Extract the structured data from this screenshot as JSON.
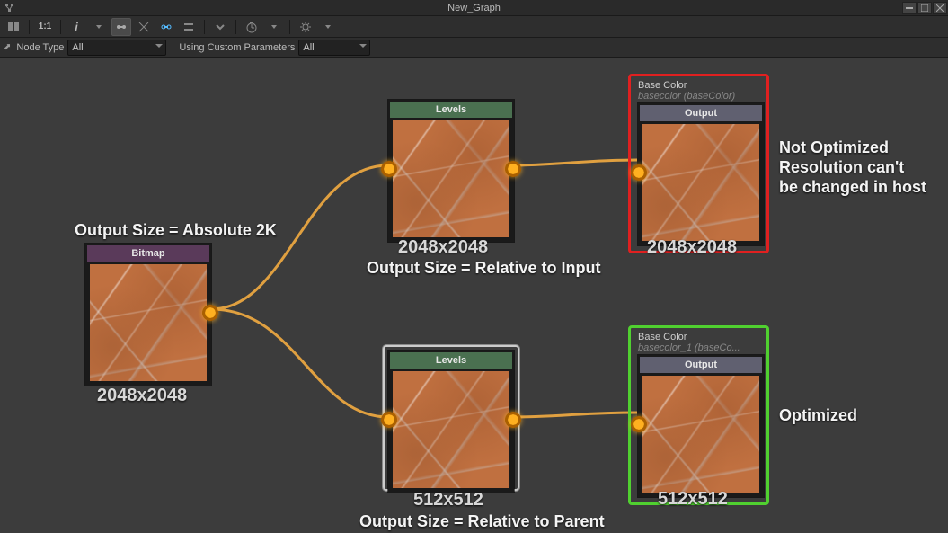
{
  "titlebar": {
    "title": "New_Graph"
  },
  "toolbar": {
    "items": [
      "split-view",
      "fit",
      "info",
      "node",
      "snap",
      "link",
      "align",
      "expand",
      "timer",
      "dropdown",
      "settings",
      "dropdown2"
    ]
  },
  "filterbar": {
    "nodetype_label": "Node Type",
    "nodetype_value": "All",
    "custom_label": "Using Custom Parameters",
    "custom_value": "All"
  },
  "nodes": {
    "bitmap": {
      "title": "Bitmap",
      "dim": "2048x2048"
    },
    "levels1": {
      "title": "Levels",
      "dim": "2048x2048"
    },
    "levels2": {
      "title": "Levels",
      "dim": "512x512"
    },
    "output1": {
      "group_title": "Base Color",
      "group_sub": "basecolor (baseColor)",
      "title": "Output",
      "dim": "2048x2048"
    },
    "output2": {
      "group_title": "Base Color",
      "group_sub": "basecolor_1 (baseCo...",
      "title": "Output",
      "dim": "512x512"
    }
  },
  "annotations": {
    "left": "Output Size = Absolute 2K",
    "mid1": "Output Size = Relative to Input",
    "mid2": "Output Size = Relative to Parent",
    "right1a": "Not Optimized",
    "right1b": "Resolution can't",
    "right1c": "be changed in host",
    "right2": "Optimized"
  }
}
